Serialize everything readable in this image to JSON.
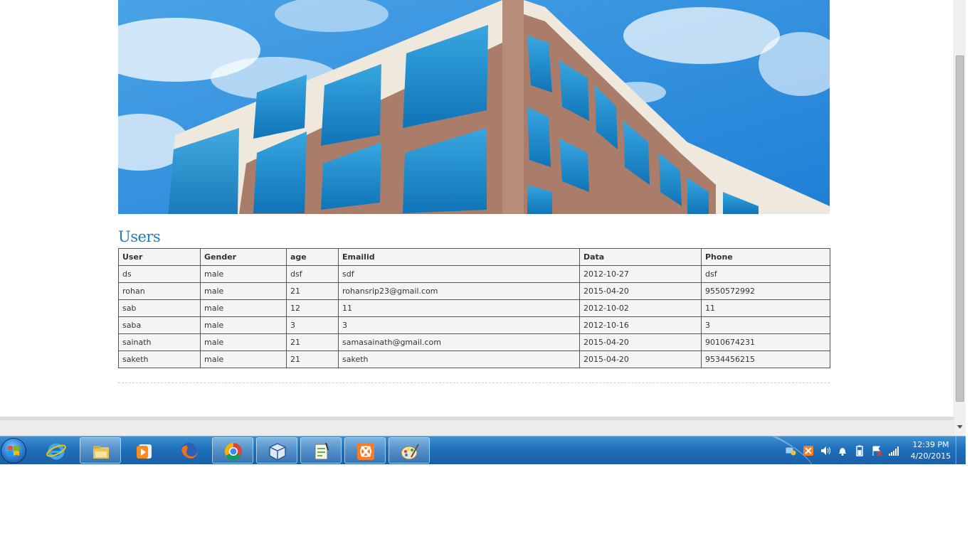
{
  "users_section": {
    "title": "Users",
    "columns": [
      "User",
      "Gender",
      "age",
      "Emailid",
      "Data",
      "Phone"
    ],
    "rows": [
      [
        "ds",
        "male",
        "dsf",
        "sdf",
        "2012-10-27",
        "dsf"
      ],
      [
        "rohan",
        "male",
        "21",
        "rohansrip23@gmail.com",
        "2015-04-20",
        "9550572992"
      ],
      [
        "sab",
        "male",
        "12",
        "11",
        "2012-10-02",
        "11"
      ],
      [
        "saba",
        "male",
        "3",
        "3",
        "2012-10-16",
        "3"
      ],
      [
        "sainath",
        "male",
        "21",
        "samasainath@gmail.com",
        "2015-04-20",
        "9010674231"
      ],
      [
        "saketh",
        "male",
        "21",
        "saketh",
        "2015-04-20",
        "9534456215"
      ]
    ]
  },
  "taskbar": {
    "apps": [
      {
        "name": "internet-explorer-icon"
      },
      {
        "name": "file-explorer-icon"
      },
      {
        "name": "media-player-icon"
      },
      {
        "name": "firefox-icon"
      },
      {
        "name": "chrome-icon"
      },
      {
        "name": "virtualbox-icon"
      },
      {
        "name": "notepad-plus-plus-icon"
      },
      {
        "name": "xampp-icon"
      },
      {
        "name": "paint-icon"
      }
    ],
    "clock": {
      "time": "12:39 PM",
      "date": "4/20/2015"
    }
  },
  "colors": {
    "title": "#1d7bc2",
    "taskbar": "#1f6fba",
    "sky": "#2f8fdc"
  }
}
